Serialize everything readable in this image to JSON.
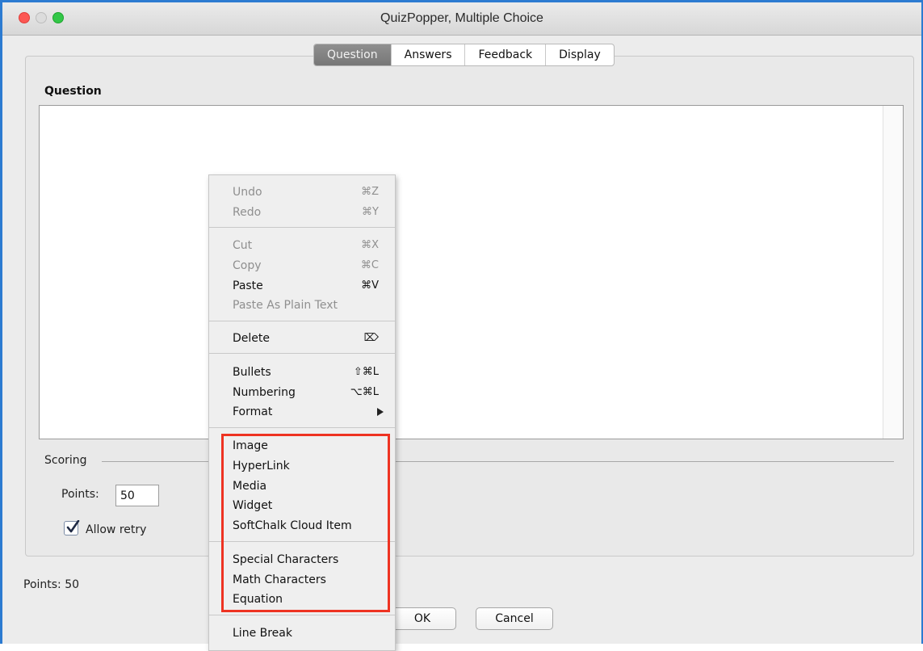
{
  "window": {
    "title": "QuizPopper, Multiple Choice"
  },
  "tabs": [
    {
      "label": "Question",
      "active": true
    },
    {
      "label": "Answers",
      "active": false
    },
    {
      "label": "Feedback",
      "active": false
    },
    {
      "label": "Display",
      "active": false
    }
  ],
  "question": {
    "label": "Question",
    "content": ""
  },
  "scoring": {
    "label": "Scoring",
    "points_label": "Points:",
    "points_value": "50",
    "allow_retry_label": "Allow retry",
    "allow_retry_checked": true
  },
  "status": {
    "points_text": "Points: 50"
  },
  "buttons": {
    "ok": "OK",
    "cancel": "Cancel"
  },
  "context_menu": {
    "items": [
      {
        "label": "Undo",
        "shortcut": "⌘Z",
        "enabled": false
      },
      {
        "label": "Redo",
        "shortcut": "⌘Y",
        "enabled": false
      },
      {
        "label": "Cut",
        "shortcut": "⌘X",
        "enabled": false
      },
      {
        "label": "Copy",
        "shortcut": "⌘C",
        "enabled": false
      },
      {
        "label": "Paste",
        "shortcut": "⌘V",
        "enabled": true
      },
      {
        "label": "Paste As Plain Text",
        "shortcut": "",
        "enabled": false
      },
      {
        "label": "Delete",
        "shortcut": "⌦",
        "enabled": true
      },
      {
        "label": "Bullets",
        "shortcut": "⇧⌘L",
        "enabled": true
      },
      {
        "label": "Numbering",
        "shortcut": "⌥⌘L",
        "enabled": true
      },
      {
        "label": "Format",
        "shortcut": "",
        "enabled": true,
        "submenu": true
      },
      {
        "label": "Image",
        "shortcut": "",
        "enabled": true
      },
      {
        "label": "HyperLink",
        "shortcut": "",
        "enabled": true
      },
      {
        "label": "Media",
        "shortcut": "",
        "enabled": true
      },
      {
        "label": "Widget",
        "shortcut": "",
        "enabled": true
      },
      {
        "label": "SoftChalk Cloud Item",
        "shortcut": "",
        "enabled": true
      },
      {
        "label": "Special Characters",
        "shortcut": "",
        "enabled": true
      },
      {
        "label": "Math Characters",
        "shortcut": "",
        "enabled": true
      },
      {
        "label": "Equation",
        "shortcut": "",
        "enabled": true
      },
      {
        "label": "Line Break",
        "shortcut": "",
        "enabled": true
      }
    ]
  },
  "colors": {
    "highlight_box": "#ee3322",
    "window_border": "#2c7bd1",
    "active_tab": "#808080"
  }
}
